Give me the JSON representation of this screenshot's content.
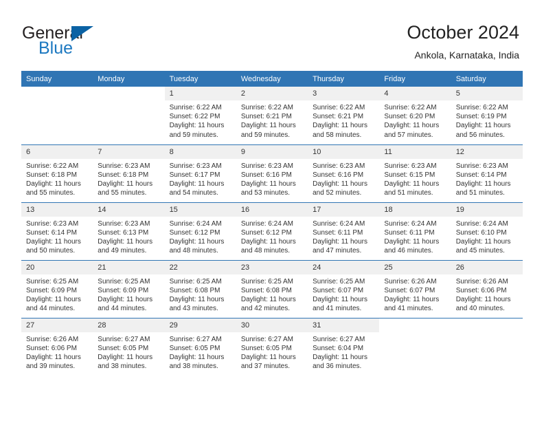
{
  "brand": {
    "word1": "General",
    "word2": "Blue",
    "triangle_color": "#0b62a4",
    "blue_color": "#1c78c0"
  },
  "header": {
    "month_title": "October 2024",
    "location": "Ankola, Karnataka, India"
  },
  "theme": {
    "header_blue": "#3075b4",
    "daynum_band": "#f0f0f0",
    "row_divider": "#3075b4"
  },
  "weekday_headers": [
    "Sunday",
    "Monday",
    "Tuesday",
    "Wednesday",
    "Thursday",
    "Friday",
    "Saturday"
  ],
  "weeks": [
    [
      {
        "day": "",
        "blank": true
      },
      {
        "day": "",
        "blank": true
      },
      {
        "day": "1",
        "sunrise": "Sunrise: 6:22 AM",
        "sunset": "Sunset: 6:22 PM",
        "daylight": "Daylight: 11 hours and 59 minutes."
      },
      {
        "day": "2",
        "sunrise": "Sunrise: 6:22 AM",
        "sunset": "Sunset: 6:21 PM",
        "daylight": "Daylight: 11 hours and 59 minutes."
      },
      {
        "day": "3",
        "sunrise": "Sunrise: 6:22 AM",
        "sunset": "Sunset: 6:21 PM",
        "daylight": "Daylight: 11 hours and 58 minutes."
      },
      {
        "day": "4",
        "sunrise": "Sunrise: 6:22 AM",
        "sunset": "Sunset: 6:20 PM",
        "daylight": "Daylight: 11 hours and 57 minutes."
      },
      {
        "day": "5",
        "sunrise": "Sunrise: 6:22 AM",
        "sunset": "Sunset: 6:19 PM",
        "daylight": "Daylight: 11 hours and 56 minutes."
      }
    ],
    [
      {
        "day": "6",
        "sunrise": "Sunrise: 6:22 AM",
        "sunset": "Sunset: 6:18 PM",
        "daylight": "Daylight: 11 hours and 55 minutes."
      },
      {
        "day": "7",
        "sunrise": "Sunrise: 6:23 AM",
        "sunset": "Sunset: 6:18 PM",
        "daylight": "Daylight: 11 hours and 55 minutes."
      },
      {
        "day": "8",
        "sunrise": "Sunrise: 6:23 AM",
        "sunset": "Sunset: 6:17 PM",
        "daylight": "Daylight: 11 hours and 54 minutes."
      },
      {
        "day": "9",
        "sunrise": "Sunrise: 6:23 AM",
        "sunset": "Sunset: 6:16 PM",
        "daylight": "Daylight: 11 hours and 53 minutes."
      },
      {
        "day": "10",
        "sunrise": "Sunrise: 6:23 AM",
        "sunset": "Sunset: 6:16 PM",
        "daylight": "Daylight: 11 hours and 52 minutes."
      },
      {
        "day": "11",
        "sunrise": "Sunrise: 6:23 AM",
        "sunset": "Sunset: 6:15 PM",
        "daylight": "Daylight: 11 hours and 51 minutes."
      },
      {
        "day": "12",
        "sunrise": "Sunrise: 6:23 AM",
        "sunset": "Sunset: 6:14 PM",
        "daylight": "Daylight: 11 hours and 51 minutes."
      }
    ],
    [
      {
        "day": "13",
        "sunrise": "Sunrise: 6:23 AM",
        "sunset": "Sunset: 6:14 PM",
        "daylight": "Daylight: 11 hours and 50 minutes."
      },
      {
        "day": "14",
        "sunrise": "Sunrise: 6:23 AM",
        "sunset": "Sunset: 6:13 PM",
        "daylight": "Daylight: 11 hours and 49 minutes."
      },
      {
        "day": "15",
        "sunrise": "Sunrise: 6:24 AM",
        "sunset": "Sunset: 6:12 PM",
        "daylight": "Daylight: 11 hours and 48 minutes."
      },
      {
        "day": "16",
        "sunrise": "Sunrise: 6:24 AM",
        "sunset": "Sunset: 6:12 PM",
        "daylight": "Daylight: 11 hours and 48 minutes."
      },
      {
        "day": "17",
        "sunrise": "Sunrise: 6:24 AM",
        "sunset": "Sunset: 6:11 PM",
        "daylight": "Daylight: 11 hours and 47 minutes."
      },
      {
        "day": "18",
        "sunrise": "Sunrise: 6:24 AM",
        "sunset": "Sunset: 6:11 PM",
        "daylight": "Daylight: 11 hours and 46 minutes."
      },
      {
        "day": "19",
        "sunrise": "Sunrise: 6:24 AM",
        "sunset": "Sunset: 6:10 PM",
        "daylight": "Daylight: 11 hours and 45 minutes."
      }
    ],
    [
      {
        "day": "20",
        "sunrise": "Sunrise: 6:25 AM",
        "sunset": "Sunset: 6:09 PM",
        "daylight": "Daylight: 11 hours and 44 minutes."
      },
      {
        "day": "21",
        "sunrise": "Sunrise: 6:25 AM",
        "sunset": "Sunset: 6:09 PM",
        "daylight": "Daylight: 11 hours and 44 minutes."
      },
      {
        "day": "22",
        "sunrise": "Sunrise: 6:25 AM",
        "sunset": "Sunset: 6:08 PM",
        "daylight": "Daylight: 11 hours and 43 minutes."
      },
      {
        "day": "23",
        "sunrise": "Sunrise: 6:25 AM",
        "sunset": "Sunset: 6:08 PM",
        "daylight": "Daylight: 11 hours and 42 minutes."
      },
      {
        "day": "24",
        "sunrise": "Sunrise: 6:25 AM",
        "sunset": "Sunset: 6:07 PM",
        "daylight": "Daylight: 11 hours and 41 minutes."
      },
      {
        "day": "25",
        "sunrise": "Sunrise: 6:26 AM",
        "sunset": "Sunset: 6:07 PM",
        "daylight": "Daylight: 11 hours and 41 minutes."
      },
      {
        "day": "26",
        "sunrise": "Sunrise: 6:26 AM",
        "sunset": "Sunset: 6:06 PM",
        "daylight": "Daylight: 11 hours and 40 minutes."
      }
    ],
    [
      {
        "day": "27",
        "sunrise": "Sunrise: 6:26 AM",
        "sunset": "Sunset: 6:06 PM",
        "daylight": "Daylight: 11 hours and 39 minutes."
      },
      {
        "day": "28",
        "sunrise": "Sunrise: 6:27 AM",
        "sunset": "Sunset: 6:05 PM",
        "daylight": "Daylight: 11 hours and 38 minutes."
      },
      {
        "day": "29",
        "sunrise": "Sunrise: 6:27 AM",
        "sunset": "Sunset: 6:05 PM",
        "daylight": "Daylight: 11 hours and 38 minutes."
      },
      {
        "day": "30",
        "sunrise": "Sunrise: 6:27 AM",
        "sunset": "Sunset: 6:05 PM",
        "daylight": "Daylight: 11 hours and 37 minutes."
      },
      {
        "day": "31",
        "sunrise": "Sunrise: 6:27 AM",
        "sunset": "Sunset: 6:04 PM",
        "daylight": "Daylight: 11 hours and 36 minutes."
      },
      {
        "day": "",
        "blank": true
      },
      {
        "day": "",
        "blank": true
      }
    ]
  ]
}
